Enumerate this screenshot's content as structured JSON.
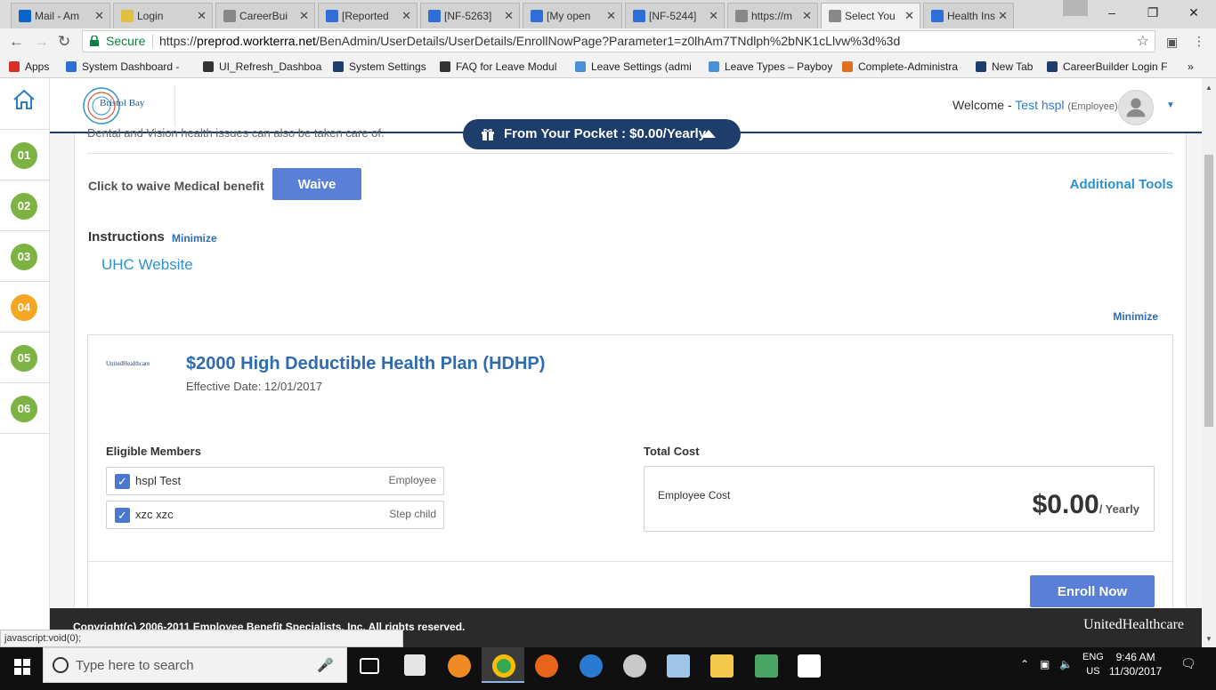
{
  "browser": {
    "tabs": [
      {
        "label": "Mail - Am",
        "color": "#0a64c8",
        "active": false
      },
      {
        "label": "Login",
        "color": "#e0c040",
        "active": false
      },
      {
        "label": "CareerBui",
        "color": "#888888",
        "active": false
      },
      {
        "label": "[Reported",
        "color": "#2d6fd6",
        "active": false
      },
      {
        "label": "[NF-5263]",
        "color": "#2d6fd6",
        "active": false
      },
      {
        "label": "[My open",
        "color": "#2d6fd6",
        "active": false
      },
      {
        "label": "[NF-5244]",
        "color": "#2d6fd6",
        "active": false
      },
      {
        "label": "https://m",
        "color": "#888888",
        "active": false
      },
      {
        "label": "Select You",
        "color": "#888888",
        "active": true
      },
      {
        "label": "Health Ins",
        "color": "#2d6fd6",
        "active": false
      }
    ],
    "secure_label": "Secure",
    "url_prefix": "https://",
    "url_host": "preprod.workterra.net",
    "url_path": "/BenAdmin/UserDetails/UserDetails/EnrollNowPage?Parameter1=z0lhAm7TNdlph%2bNK1cLlvw%3d%3d",
    "bookmarks": [
      {
        "label": "Apps",
        "color": "#d93025"
      },
      {
        "label": "System Dashboard - ",
        "color": "#2d6fd6"
      },
      {
        "label": "UI_Refresh_Dashboar",
        "color": "#333333"
      },
      {
        "label": "System Settings",
        "color": "#1f3d6b"
      },
      {
        "label": "FAQ for Leave Modul",
        "color": "#333333"
      },
      {
        "label": "Leave Settings (admi",
        "color": "#4a90d9"
      },
      {
        "label": "Leave Types – Payboy",
        "color": "#4a90d9"
      },
      {
        "label": "Complete-Administra",
        "color": "#e07020"
      },
      {
        "label": "New Tab",
        "color": "#1f3d6b"
      },
      {
        "label": "CareerBuilder Login F",
        "color": "#1f3d6b"
      }
    ],
    "status_url": "javascript:void(0);"
  },
  "sidebar": {
    "steps": [
      "01",
      "02",
      "03",
      "04",
      "05",
      "06"
    ],
    "current_step": "04"
  },
  "header": {
    "logo_text": "Bristol Bay",
    "welcome_prefix": "Welcome - ",
    "user_name": "Test hspl",
    "user_role": "(Employee)"
  },
  "pocket": {
    "label": "From Your Pocket : ",
    "amount": "$0.00/Yearly"
  },
  "content": {
    "cut_text": "Dental and Vision health issues can also be taken care of.",
    "waive_label": "Click to waive Medical benefit",
    "waive_button": "Waive",
    "additional_tools": "Additional Tools",
    "instructions_label": "Instructions",
    "minimize_label": "Minimize",
    "uhc_link": "UHC Website",
    "minimize_label_2": "Minimize"
  },
  "plan": {
    "carrier_logo": "UnitedHealthcare",
    "title": "$2000 High Deductible Health Plan (HDHP)",
    "effective_date": "Effective Date: 12/01/2017",
    "eligible_label": "Eligible Members",
    "members": [
      {
        "name": "hspl Test",
        "relation": "Employee",
        "checked": true
      },
      {
        "name": "xzc xzc",
        "relation": "Step child",
        "checked": true
      }
    ],
    "total_label": "Total Cost",
    "cost_label": "Employee Cost",
    "cost_value": "$0.00",
    "cost_period": "/ Yearly",
    "enroll_button": "Enroll Now"
  },
  "footer": {
    "copyright": "Copyright(c) 2006-2011 Employee Benefit Specialists, Inc. All rights reserved.",
    "logo": "UnitedHealthcare"
  },
  "taskbar": {
    "search_placeholder": "Type here to search",
    "lang": "ENG",
    "region": "US",
    "time": "9:46 AM",
    "date": "11/30/2017"
  },
  "colors": {
    "navy": "#1f3d6b",
    "button_blue": "#5a7fd6",
    "link_blue": "#2e92d0",
    "step_done": "#7cb342",
    "step_current": "#f5a623"
  }
}
